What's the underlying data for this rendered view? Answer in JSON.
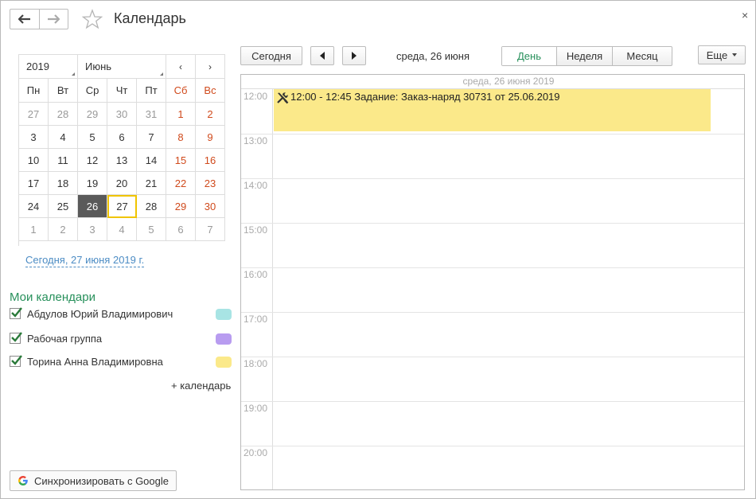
{
  "window": {
    "title": "Календарь",
    "close": "×"
  },
  "mini_calendar": {
    "year": "2019",
    "month": "Июнь",
    "prev": "‹",
    "next": "›",
    "weekdays": [
      "Пн",
      "Вт",
      "Ср",
      "Чт",
      "Пт",
      "Сб",
      "Вс"
    ],
    "weeks": [
      [
        "27",
        "28",
        "29",
        "30",
        "31",
        "1",
        "2"
      ],
      [
        "3",
        "4",
        "5",
        "6",
        "7",
        "8",
        "9"
      ],
      [
        "10",
        "11",
        "12",
        "13",
        "14",
        "15",
        "16"
      ],
      [
        "17",
        "18",
        "19",
        "20",
        "21",
        "22",
        "23"
      ],
      [
        "24",
        "25",
        "26",
        "27",
        "28",
        "29",
        "30"
      ],
      [
        "1",
        "2",
        "3",
        "4",
        "5",
        "6",
        "7"
      ]
    ],
    "today_link": "Сегодня, 27 июня 2019 г."
  },
  "my_calendars": {
    "title": "Мои календари",
    "items": [
      {
        "name": "Абдулов Юрий Владимирович",
        "color": "#a8e4e4"
      },
      {
        "name": "Рабочая группа",
        "color": "#b89cf0"
      },
      {
        "name": "Торина Анна Владимировна",
        "color": "#fbe98a"
      }
    ],
    "add_label": "+ календарь"
  },
  "google_sync": {
    "label": "Синхронизировать с Google"
  },
  "toolbar": {
    "today": "Сегодня",
    "current_date": "среда, 26 июня",
    "views": [
      "День",
      "Неделя",
      "Месяц"
    ],
    "more": "Еще"
  },
  "day_view": {
    "header": "среда, 26 июня 2019",
    "hours": [
      "12:00",
      "13:00",
      "14:00",
      "15:00",
      "16:00",
      "17:00",
      "18:00",
      "19:00",
      "20:00"
    ],
    "event": {
      "text": "12:00 - 12:45 Задание: Заказ-наряд 30731 от 25.06.2019",
      "color": "#fbe98a"
    }
  },
  "colors": {
    "accent_green": "#27905b",
    "weekend_red": "#d04a1c",
    "link_blue": "#4c8cc4"
  }
}
